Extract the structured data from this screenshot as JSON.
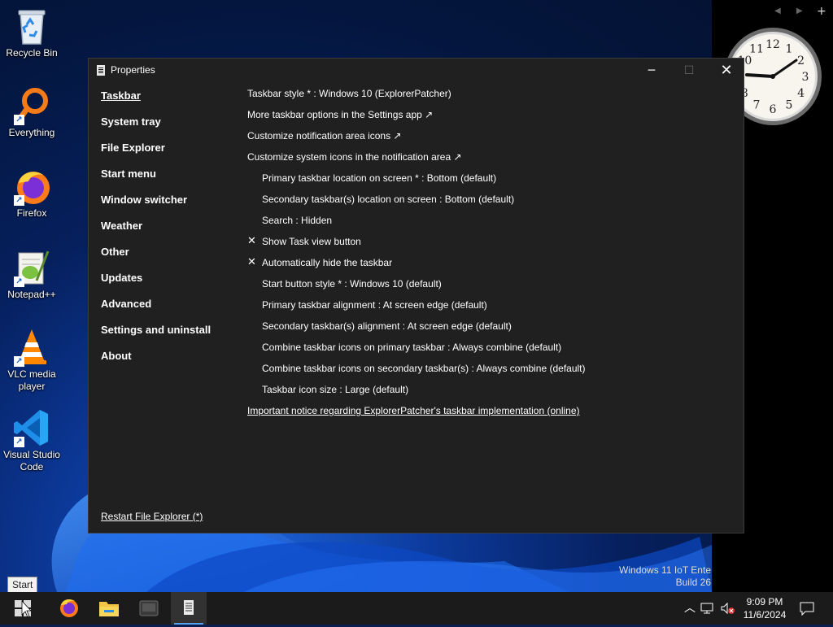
{
  "desktop": {
    "icons": [
      {
        "label": "Recycle Bin",
        "icon": "recycle-bin-icon"
      },
      {
        "label": "Everything",
        "icon": "everything-search-icon"
      },
      {
        "label": "Firefox",
        "icon": "firefox-icon"
      },
      {
        "label": "Notepad++",
        "icon": "notepad-plus-plus-icon"
      },
      {
        "label": "VLC media player",
        "icon": "vlc-icon"
      },
      {
        "label": "Visual Studio Code",
        "icon": "vscode-icon"
      }
    ],
    "watermark": {
      "line1": "Windows 11 IoT Ente",
      "line2": "Build 26"
    }
  },
  "window": {
    "title": "Properties",
    "controls": {
      "minimize": "─",
      "maximize": "☐",
      "close": "✕"
    },
    "nav": [
      {
        "label": "Taskbar",
        "active": true
      },
      {
        "label": "System tray"
      },
      {
        "label": "File Explorer"
      },
      {
        "label": "Start menu"
      },
      {
        "label": "Window switcher"
      },
      {
        "label": "Weather"
      },
      {
        "label": "Other"
      },
      {
        "label": "Updates"
      },
      {
        "label": "Advanced"
      },
      {
        "label": "Settings and uninstall"
      },
      {
        "label": "About"
      }
    ],
    "options": [
      {
        "text": "Taskbar style * : Windows 10 (ExplorerPatcher)",
        "level": 0
      },
      {
        "text": "More taskbar options in the Settings app ↗",
        "level": 0
      },
      {
        "text": "Customize notification area icons ↗",
        "level": 0
      },
      {
        "text": "Customize system icons in the notification area ↗",
        "level": 0
      },
      {
        "text": "Primary taskbar location on screen * : Bottom (default)",
        "level": 1
      },
      {
        "text": "Secondary taskbar(s) location on screen : Bottom (default)",
        "level": 1
      },
      {
        "text": "Search : Hidden",
        "level": 1
      },
      {
        "text": "Show Task view button",
        "level": 1,
        "checked": true
      },
      {
        "text": "Automatically hide the taskbar",
        "level": 1,
        "checked": true
      },
      {
        "text": "Start button style * : Windows 10 (default)",
        "level": 1
      },
      {
        "text": "Primary taskbar alignment : At screen edge (default)",
        "level": 1
      },
      {
        "text": "Secondary taskbar(s) alignment : At screen edge (default)",
        "level": 1
      },
      {
        "text": "Combine taskbar icons on primary taskbar : Always combine (default)",
        "level": 1
      },
      {
        "text": "Combine taskbar icons on secondary taskbar(s) : Always combine (default)",
        "level": 1
      },
      {
        "text": "Taskbar icon size : Large (default)",
        "level": 1
      },
      {
        "text": "Important notice regarding ExplorerPatcher's taskbar implementation (online)",
        "level": 0,
        "link": true
      }
    ],
    "check_glyph": "✕",
    "restart_label": "Restart File Explorer (*)"
  },
  "gadget": {
    "nav": "◀ ▶",
    "add": "+",
    "clock_numbers": [
      "12",
      "1",
      "2",
      "3",
      "4",
      "5",
      "6",
      "7",
      "8",
      "9",
      "10",
      "11"
    ],
    "time": "9:09"
  },
  "tooltip": "Start",
  "taskbar": {
    "apps": [
      "start-icon",
      "firefox-icon",
      "file-explorer-icon",
      "app-icon",
      "properties-icon"
    ],
    "tray": {
      "chevron": "︿",
      "time": "9:09 PM",
      "date": "11/6/2024"
    }
  },
  "colors": {
    "window_bg": "#202020",
    "taskbar_bg": "#1b1b1b",
    "accent": "#5aa0e8"
  }
}
